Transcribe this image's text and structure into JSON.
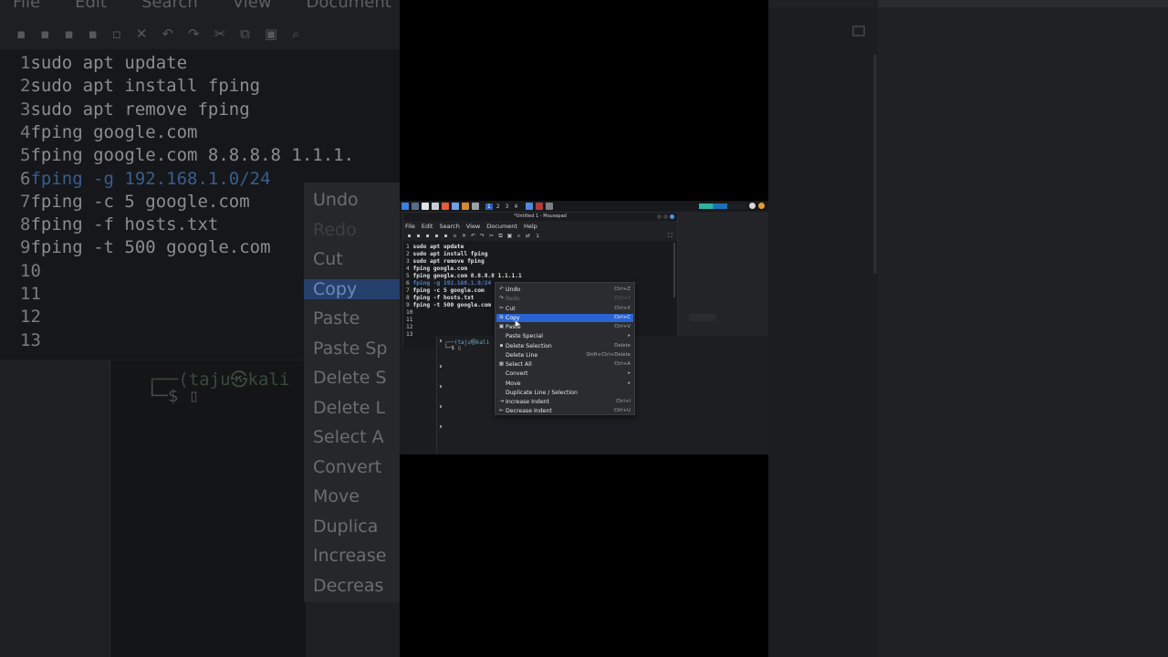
{
  "app": {
    "window_title": "*Untitled 1 - Mousepad",
    "menubar": [
      "File",
      "Edit",
      "Search",
      "View",
      "Document",
      "Help"
    ]
  },
  "taskbar": {
    "workspaces": [
      "1",
      "2",
      "3",
      "4"
    ],
    "active_workspace": "1"
  },
  "editor": {
    "lines": [
      {
        "num": "1",
        "text": "sudo apt update"
      },
      {
        "num": "2",
        "text": "sudo apt install fping"
      },
      {
        "num": "3",
        "text": "sudo apt remove fping"
      },
      {
        "num": "4",
        "text": "fping google.com"
      },
      {
        "num": "5",
        "text": "fping google.com 8.8.8.8 1.1.1.1"
      },
      {
        "num": "6",
        "text": "fping -g 192.168.1.0/24"
      },
      {
        "num": "7",
        "text": "fping -c 5 google.com"
      },
      {
        "num": "8",
        "text": "fping -f hosts.txt"
      },
      {
        "num": "9",
        "text": "fping -t 500 google.com"
      },
      {
        "num": "10",
        "text": ""
      },
      {
        "num": "11",
        "text": ""
      },
      {
        "num": "12",
        "text": ""
      },
      {
        "num": "13",
        "text": ""
      }
    ],
    "selected_line": "6"
  },
  "terminal": {
    "prompt_user": "┌──(taju㉿kali",
    "prompt_line": "└─$ ▯"
  },
  "context_menu": {
    "items": [
      {
        "label": "Undo",
        "shortcut": "Ctrl+Z",
        "icon": "undo-icon",
        "glyph": "↶",
        "state": "normal"
      },
      {
        "label": "Redo",
        "shortcut": "Ctrl+Y",
        "icon": "redo-icon",
        "glyph": "↷",
        "state": "disabled"
      },
      {
        "label": "Cut",
        "shortcut": "Ctrl+X",
        "icon": "cut-icon",
        "glyph": "✂",
        "state": "normal"
      },
      {
        "label": "Copy",
        "shortcut": "Ctrl+C",
        "icon": "copy-icon",
        "glyph": "⧉",
        "state": "highlighted"
      },
      {
        "label": "Paste",
        "shortcut": "Ctrl+V",
        "icon": "paste-icon",
        "glyph": "▣",
        "state": "normal"
      },
      {
        "label": "Paste Special",
        "shortcut": "▸",
        "icon": "",
        "glyph": "",
        "state": "normal"
      },
      {
        "label": "Delete Selection",
        "shortcut": "Delete",
        "icon": "delete-icon",
        "glyph": "▪",
        "state": "normal"
      },
      {
        "label": "Delete Line",
        "shortcut": "Shift+Ctrl+Delete",
        "icon": "",
        "glyph": "",
        "state": "normal"
      },
      {
        "label": "Select All",
        "shortcut": "Ctrl+A",
        "icon": "select-all-icon",
        "glyph": "▦",
        "state": "normal"
      },
      {
        "label": "Convert",
        "shortcut": "▸",
        "icon": "",
        "glyph": "",
        "state": "normal"
      },
      {
        "label": "Move",
        "shortcut": "▸",
        "icon": "",
        "glyph": "",
        "state": "normal"
      },
      {
        "label": "Duplicate Line / Selection",
        "shortcut": "",
        "icon": "",
        "glyph": "",
        "state": "normal"
      },
      {
        "label": "Increase Indent",
        "shortcut": "Ctrl+I",
        "icon": "increase-indent-icon",
        "glyph": "⇥",
        "state": "normal"
      },
      {
        "label": "Decrease Indent",
        "shortcut": "Ctrl+U",
        "icon": "decrease-indent-icon",
        "glyph": "⇤",
        "state": "normal"
      }
    ]
  },
  "backdrop": {
    "menubar": [
      "File",
      "Edit",
      "Search",
      "View",
      "Document",
      "Help"
    ],
    "lines": [
      {
        "num": "1",
        "text": "sudo apt update"
      },
      {
        "num": "2",
        "text": "sudo apt install fping"
      },
      {
        "num": "3",
        "text": "sudo apt remove fping"
      },
      {
        "num": "4",
        "text": "fping google.com"
      },
      {
        "num": "5",
        "text": "fping google.com 8.8.8.8 1.1.1."
      },
      {
        "num": "6",
        "text": "fping -g 192.168.1.0/24"
      },
      {
        "num": "7",
        "text": "fping -c 5 google.com"
      },
      {
        "num": "8",
        "text": "fping -f hosts.txt"
      },
      {
        "num": "9",
        "text": "fping -t 500 google.com"
      },
      {
        "num": "10",
        "text": ""
      },
      {
        "num": "11",
        "text": ""
      },
      {
        "num": "12",
        "text": ""
      },
      {
        "num": "13",
        "text": ""
      }
    ],
    "menu": [
      "Undo",
      "Redo",
      "Cut",
      "Copy",
      "Paste",
      "Paste Sp",
      "Delete S",
      "Delete L",
      "Select A",
      "Convert",
      "Move",
      "Duplica",
      "Increase",
      "Decreas"
    ],
    "terminal_prompt": "┌──(taju㉿kali",
    "terminal_line": "└─$ ▯"
  },
  "colors": {
    "highlight": "#2a63d3",
    "selection_text": "#4f7fc9",
    "menu_bg": "#2b2c30",
    "editor_bg": "#18191b"
  }
}
